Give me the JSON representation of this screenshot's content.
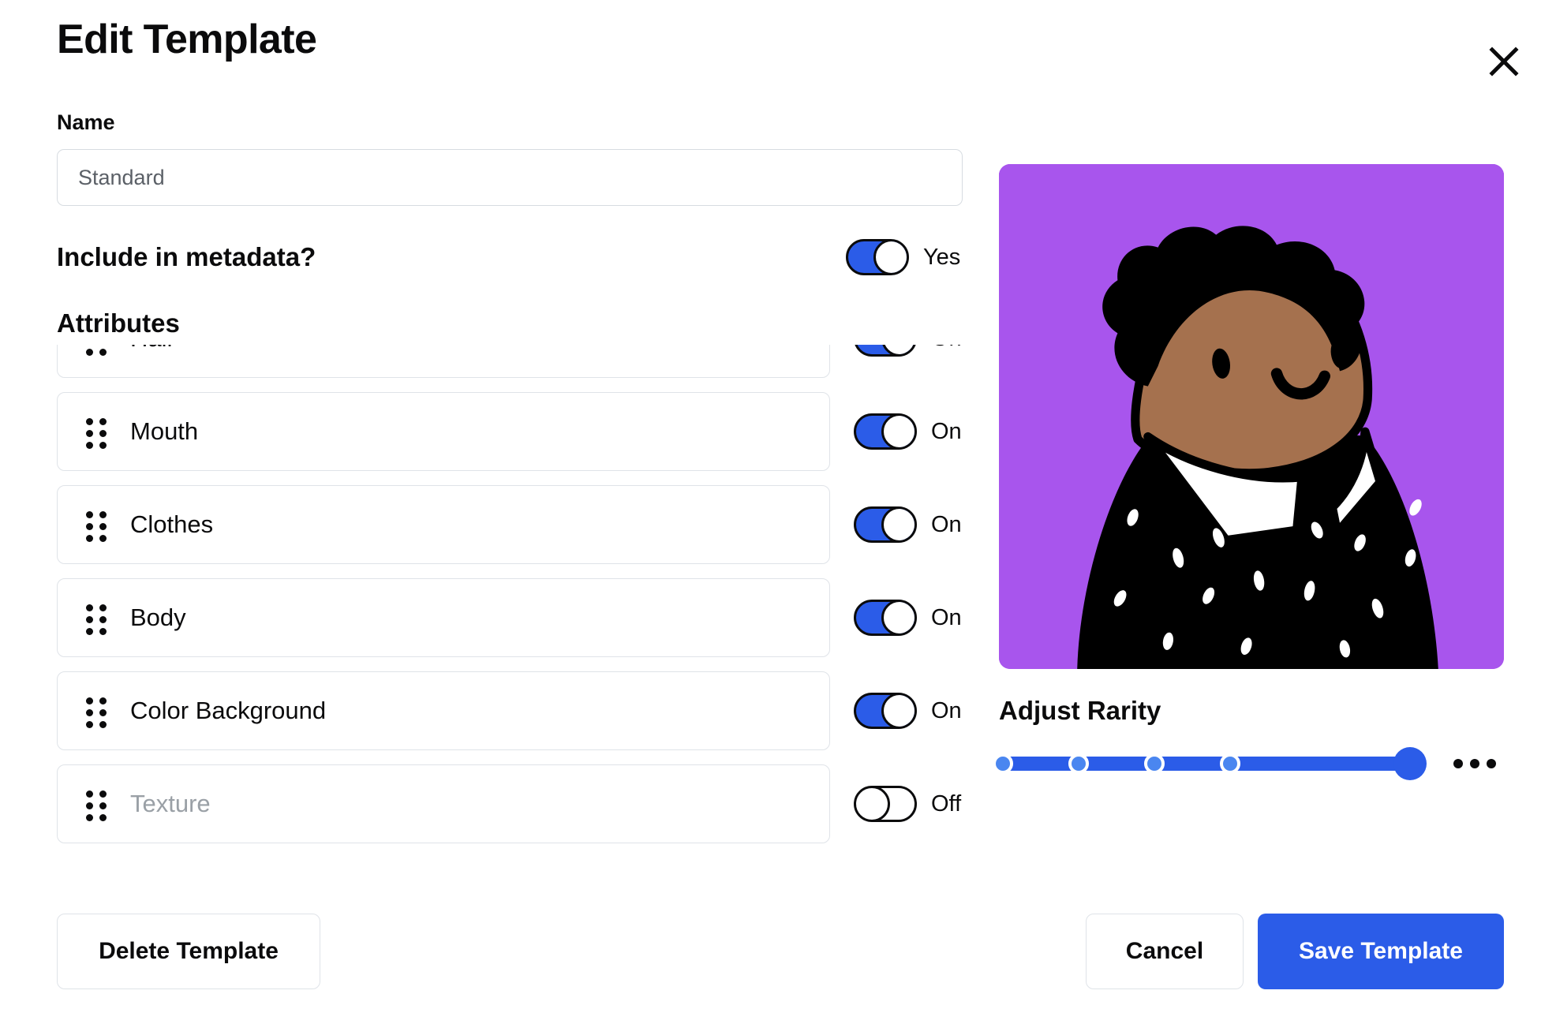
{
  "header": {
    "title": "Edit Template",
    "close_icon": "close-icon"
  },
  "name_field": {
    "label": "Name",
    "value": "Standard",
    "placeholder": "Standard"
  },
  "metadata": {
    "label": "Include in metadata?",
    "toggle_state": "Yes"
  },
  "attributes": {
    "heading": "Attributes",
    "items": [
      {
        "name": "Hair",
        "toggle": "On",
        "enabled": true
      },
      {
        "name": "Mouth",
        "toggle": "On",
        "enabled": true
      },
      {
        "name": "Clothes",
        "toggle": "On",
        "enabled": true
      },
      {
        "name": "Body",
        "toggle": "On",
        "enabled": true
      },
      {
        "name": "Color Background",
        "toggle": "On",
        "enabled": true
      },
      {
        "name": "Texture",
        "toggle": "Off",
        "enabled": false
      }
    ]
  },
  "preview": {
    "background_color": "#a855ed",
    "skin_color": "#a5714e",
    "hair_color": "#000000",
    "shirt_color": "#ffffff",
    "jacket_color": "#000000",
    "alt": "avatar-preview"
  },
  "rarity": {
    "title": "Adjust Rarity",
    "value": 100,
    "steps": [
      0,
      20,
      40,
      60,
      100
    ],
    "menu_icon": "ellipsis-icon"
  },
  "footer": {
    "delete_label": "Delete Template",
    "cancel_label": "Cancel",
    "save_label": "Save Template"
  },
  "colors": {
    "accent_blue": "#2b5ce8",
    "step_blue": "#4a86f0",
    "border_grey": "#dfe3e8",
    "muted_text": "#9aa0a6"
  }
}
